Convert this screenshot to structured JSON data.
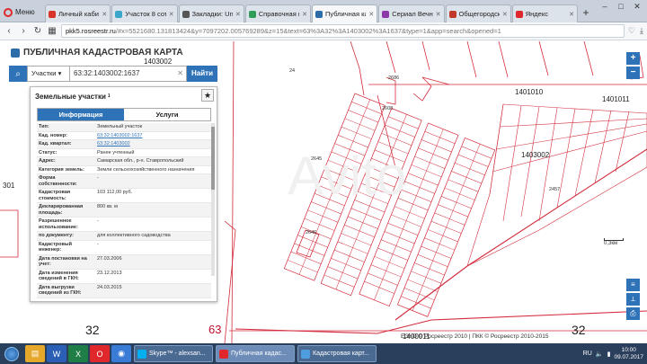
{
  "browser": {
    "menu_label": "Меню",
    "tabs": [
      {
        "label": "Личный кабин",
        "color": "#d9342b"
      },
      {
        "label": "Участок 8 сот",
        "color": "#3aa6c9"
      },
      {
        "label": "Закладки: Uns",
        "color": "#555555"
      },
      {
        "label": "Справочная и",
        "color": "#2f9e5a"
      },
      {
        "label": "Публичная ка",
        "color": "#2c6ca8",
        "active": true
      },
      {
        "label": "Сериал Вечнь",
        "color": "#8b3aa8"
      },
      {
        "label": "Общегородск",
        "color": "#c0392b"
      },
      {
        "label": "Яндекс",
        "color": "#e0272b"
      }
    ],
    "new_tab": "+",
    "url_host": "pkk5.rosreestr.ru",
    "url_rest": "/#x=5521680.131813424&y=7097202.005769289&z=15&text=63%3A32%3A1403002%3A1637&type=1&app=search&opened=1"
  },
  "app": {
    "title": "ПУБЛИЧНАЯ КАДАСТРОВАЯ КАРТА",
    "search": {
      "type": "Участки",
      "query": "63:32:1403002:1637",
      "button": "Найти"
    },
    "panel": {
      "title": "Земельные участки",
      "title_sup": "1",
      "tab_info": "Информация",
      "tab_services": "Услуги",
      "rows": [
        {
          "label": "Тип:",
          "value": "Земельный участок"
        },
        {
          "label": "Кад. номер:",
          "value": "63:32:1403002:1637",
          "link": true
        },
        {
          "label": "Кад. квартал:",
          "value": "63:32:1403002",
          "link": true
        },
        {
          "label": "Статус:",
          "value": "Ранее учтенный"
        },
        {
          "label": "Адрес:",
          "value": "Самарская обл., р-н. Ставропольский"
        },
        {
          "label": "Категория земель:",
          "value": "Земли сельскохозяйственного назначения"
        },
        {
          "label": "Форма собственности:",
          "value": "-"
        },
        {
          "label": "Кадастровая стоимость:",
          "value": "103 112,00 руб."
        },
        {
          "label": "Декларированная площадь:",
          "value": "800 кв. м"
        },
        {
          "label": "Разрешенное использование:",
          "value": "-"
        },
        {
          "label": "по документу:",
          "value": "для коллективного садоводства"
        },
        {
          "label": "Кадастровый инженер:",
          "value": "-"
        },
        {
          "label": "Дата постановки на учет:",
          "value": "27.03.2006"
        },
        {
          "label": "Дата изменения сведений в ГКН:",
          "value": "23.12.2013"
        },
        {
          "label": "Дата выгрузки сведений из ГКН:",
          "value": "24.03.2015"
        }
      ]
    },
    "map_labels": {
      "q1": "1403002",
      "q2": "1401010",
      "q3": "1401011",
      "q4": "1403002",
      "q5": "1403002",
      "q6": "1400011",
      "n63": "63",
      "n32a": "32",
      "n32b": "32",
      "n301": "301",
      "n24": "24",
      "n2686": "2686",
      "n2645": "2645",
      "n2646": "2646",
      "n2608": "2608",
      "n2457": "2457"
    },
    "scale": "0,3км",
    "copyright": "ЕЭКО © Росреестр 2010 | ПКК © Росреестр 2010-2015"
  },
  "taskbar": {
    "items": [
      {
        "label": "Skype™ - alexsan...",
        "color": "#00aff0"
      },
      {
        "label": "Публичная кадас...",
        "color": "#e0272b",
        "active": true
      },
      {
        "label": "Кадастровая карт...",
        "color": "#4e9de0"
      }
    ],
    "lang": "RU",
    "time": "10:00",
    "date": "09.07.2017"
  }
}
